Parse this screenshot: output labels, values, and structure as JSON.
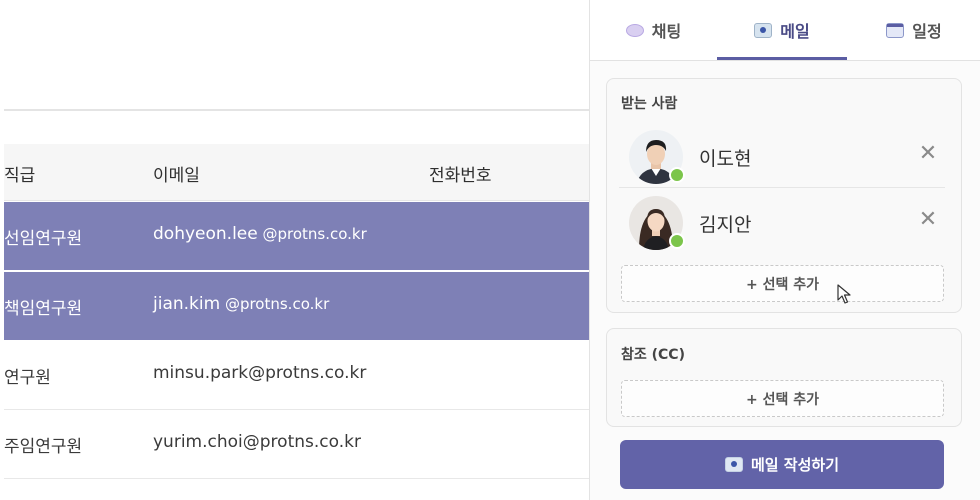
{
  "table": {
    "headers": {
      "rank": "직급",
      "email": "이메일",
      "phone": "전화번호"
    },
    "rows": [
      {
        "rank": "선임연구원",
        "user": "dohyeon.lee",
        "domain": " @protns.co.kr",
        "selected": true
      },
      {
        "rank": "책임연구원",
        "user": "jian.kim",
        "domain": " @protns.co.kr",
        "selected": true
      },
      {
        "rank": "연구원",
        "user": "minsu.park@protns.co.kr",
        "domain": "",
        "selected": false
      },
      {
        "rank": "주임연구원",
        "user": "yurim.choi@protns.co.kr",
        "domain": "",
        "selected": false
      }
    ]
  },
  "tabs": [
    {
      "label": "채팅",
      "icon": "chat-icon"
    },
    {
      "label": "메일",
      "icon": "mail-icon",
      "active": true
    },
    {
      "label": "일정",
      "icon": "calendar-icon"
    }
  ],
  "recipients": {
    "title": "받는 사람",
    "people": [
      {
        "name": "이도현",
        "status": "online",
        "remove": "✕"
      },
      {
        "name": "김지안",
        "status": "online",
        "remove": "✕"
      }
    ],
    "add_label": "+ 선택 추가"
  },
  "cc": {
    "title": "참조 (CC)",
    "add_label": "+ 선택 추가"
  },
  "compose": {
    "label": "메일 작성하기"
  },
  "colors": {
    "selected_row": "#7e80b6",
    "accent": "#6263a8",
    "online": "#7cc54b"
  }
}
